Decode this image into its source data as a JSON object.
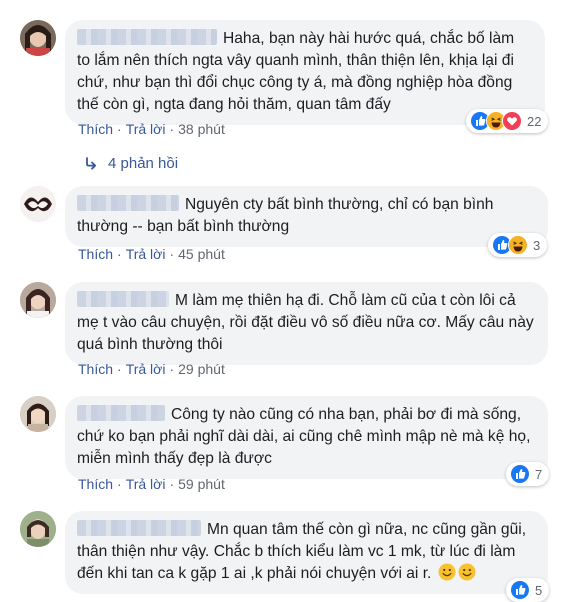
{
  "comments": [
    {
      "text": "Haha, bạn này hài hước quá, chắc bố làm to lắm nên thích ngta vây quanh mình, thân thiện lên, khịa lại đi chứ, như bạn thì đổi chục công ty á, mà đồng nghiệp hòa đồng thế còn gì, ngta đang hỏi thăm, quan tâm đấy",
      "like": "Thích",
      "reply": "Trả lời",
      "time": "38 phút",
      "reactions": [
        "like-icon",
        "haha-icon",
        "love-icon"
      ],
      "reaction_count": "22"
    },
    {
      "text": "Nguyên cty bất bình thường, chỉ có bạn bình thường -- bạn bất bình thường",
      "like": "Thích",
      "reply": "Trả lời",
      "time": "45 phút",
      "reactions": [
        "like-icon",
        "haha-icon"
      ],
      "reaction_count": "3"
    },
    {
      "text": "M làm mẹ thiên hạ đi. Chỗ làm cũ của t còn lôi cả mẹ t vào câu chuyện, rồi đặt điều vô số điều nữa cơ. Mấy câu này quá bình thường thôi",
      "like": "Thích",
      "reply": "Trả lời",
      "time": "29 phút"
    },
    {
      "text": "Công ty nào cũng có nha bạn, phải bơ đi mà sống, chứ ko bạn phải nghĩ dài dài, ai cũng chê mình mập nè mà kệ họ, miễn mình thấy đẹp là được",
      "like": "Thích",
      "reply": "Trả lời",
      "time": "59 phút",
      "reactions": [
        "like-icon"
      ],
      "reaction_count": "7"
    },
    {
      "text": "Mn quan tâm thế còn gì nữa, nc cũng gần gũi, thân thiện như vậy. Chắc b thích kiểu làm vc 1 mk, từ lúc đi làm đến khi tan ca k gặp 1 ai ,k phải nói chuyện với ai r.",
      "emojis": [
        "smile-emoji",
        "smile-emoji"
      ],
      "reactions": [
        "like-icon"
      ],
      "reaction_count": "5"
    }
  ],
  "replies_label": "4 phản hồi",
  "colors": {
    "link": "#385898",
    "bubble": "#f2f3f5",
    "meta": "#616770"
  }
}
